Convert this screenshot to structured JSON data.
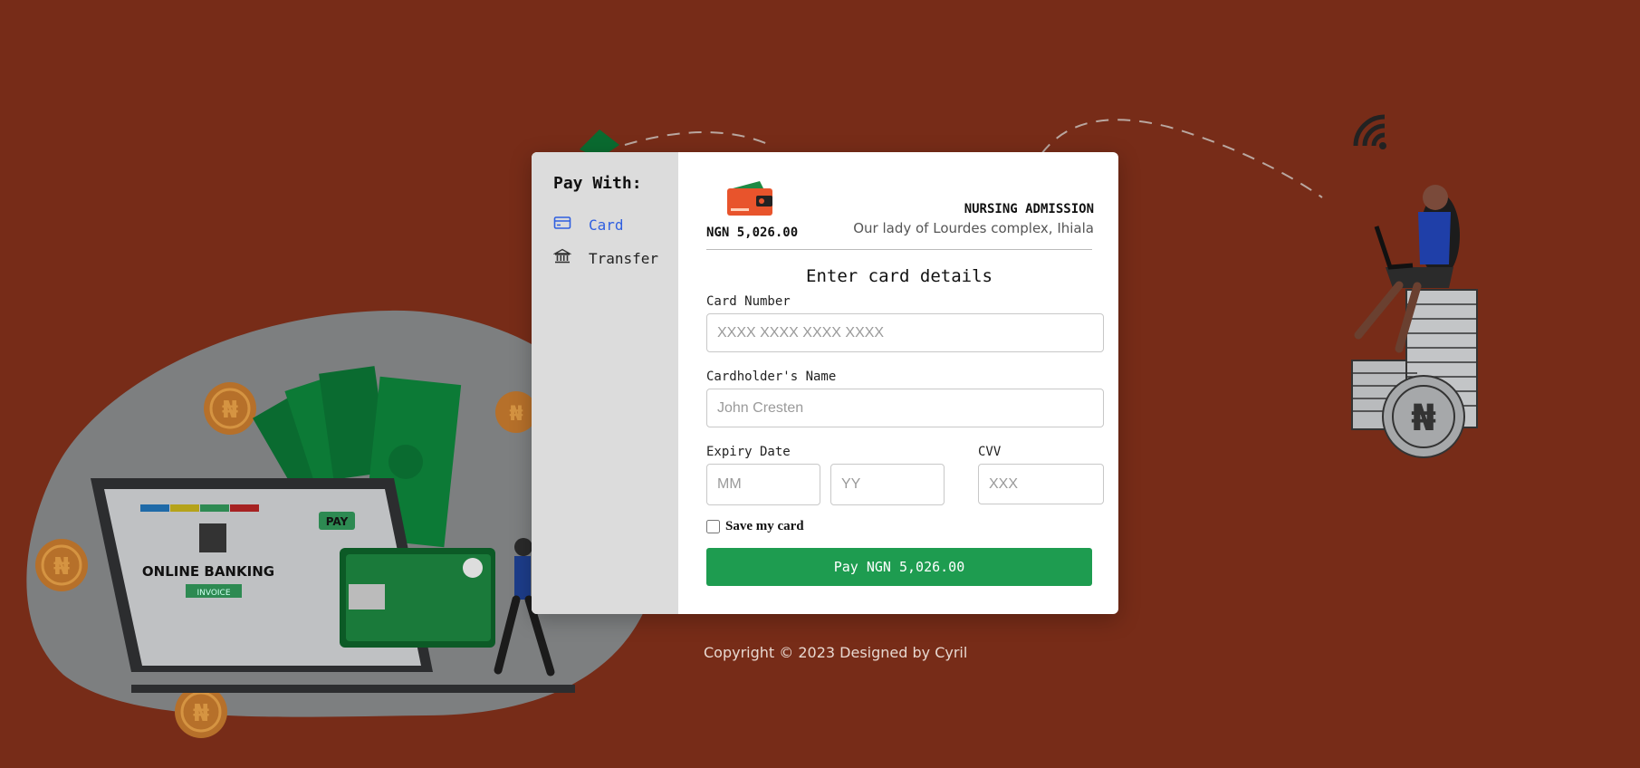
{
  "sidebar": {
    "title": "Pay With:",
    "items": [
      {
        "label": "Card",
        "icon": "credit-card-icon",
        "active": true
      },
      {
        "label": "Transfer",
        "icon": "bank-icon",
        "active": false
      }
    ]
  },
  "header": {
    "logo_icon": "wallet-logo-icon",
    "amount": "NGN 5,026.00",
    "merchant_name": "NURSING ADMISSION",
    "merchant_address": "Our lady of Lourdes complex, Ihiala"
  },
  "form": {
    "title": "Enter card details",
    "card_number": {
      "label": "Card Number",
      "placeholder": "XXXX XXXX XXXX XXXX",
      "value": ""
    },
    "cardholder_name": {
      "label": "Cardholder's Name",
      "placeholder": "John Cresten",
      "value": ""
    },
    "expiry": {
      "label": "Expiry Date",
      "month_placeholder": "MM",
      "year_placeholder": "YY"
    },
    "cvv": {
      "label": "CVV",
      "placeholder": "XXX"
    },
    "save_card_label": "Save my card",
    "save_card_checked": false,
    "pay_button_label": "Pay NGN 5,026.00"
  },
  "footer": {
    "copyright": "Copyright © 2023 Designed by Cyril"
  },
  "colors": {
    "background": "#772c18",
    "accent_green": "#1e9c50",
    "active_blue": "#2f5fe0",
    "sidebar_bg": "#dcdcdc"
  }
}
